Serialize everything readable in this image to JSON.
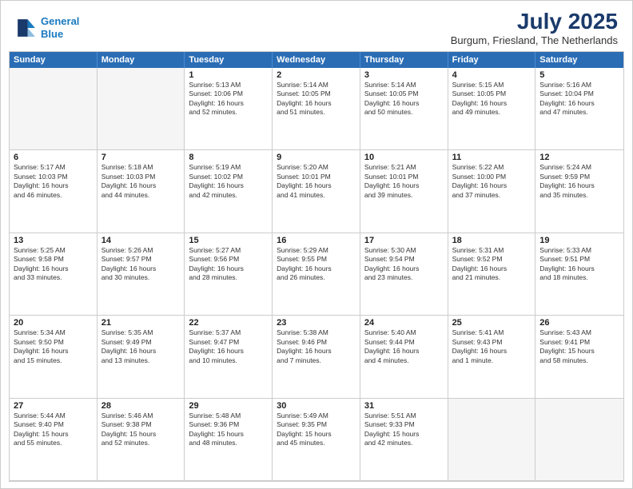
{
  "header": {
    "logo_line1": "General",
    "logo_line2": "Blue",
    "month_year": "July 2025",
    "location": "Burgum, Friesland, The Netherlands"
  },
  "day_headers": [
    "Sunday",
    "Monday",
    "Tuesday",
    "Wednesday",
    "Thursday",
    "Friday",
    "Saturday"
  ],
  "cells": [
    {
      "day": "",
      "info": ""
    },
    {
      "day": "",
      "info": ""
    },
    {
      "day": "1",
      "info": "Sunrise: 5:13 AM\nSunset: 10:06 PM\nDaylight: 16 hours\nand 52 minutes."
    },
    {
      "day": "2",
      "info": "Sunrise: 5:14 AM\nSunset: 10:05 PM\nDaylight: 16 hours\nand 51 minutes."
    },
    {
      "day": "3",
      "info": "Sunrise: 5:14 AM\nSunset: 10:05 PM\nDaylight: 16 hours\nand 50 minutes."
    },
    {
      "day": "4",
      "info": "Sunrise: 5:15 AM\nSunset: 10:05 PM\nDaylight: 16 hours\nand 49 minutes."
    },
    {
      "day": "5",
      "info": "Sunrise: 5:16 AM\nSunset: 10:04 PM\nDaylight: 16 hours\nand 47 minutes."
    },
    {
      "day": "6",
      "info": "Sunrise: 5:17 AM\nSunset: 10:03 PM\nDaylight: 16 hours\nand 46 minutes."
    },
    {
      "day": "7",
      "info": "Sunrise: 5:18 AM\nSunset: 10:03 PM\nDaylight: 16 hours\nand 44 minutes."
    },
    {
      "day": "8",
      "info": "Sunrise: 5:19 AM\nSunset: 10:02 PM\nDaylight: 16 hours\nand 42 minutes."
    },
    {
      "day": "9",
      "info": "Sunrise: 5:20 AM\nSunset: 10:01 PM\nDaylight: 16 hours\nand 41 minutes."
    },
    {
      "day": "10",
      "info": "Sunrise: 5:21 AM\nSunset: 10:01 PM\nDaylight: 16 hours\nand 39 minutes."
    },
    {
      "day": "11",
      "info": "Sunrise: 5:22 AM\nSunset: 10:00 PM\nDaylight: 16 hours\nand 37 minutes."
    },
    {
      "day": "12",
      "info": "Sunrise: 5:24 AM\nSunset: 9:59 PM\nDaylight: 16 hours\nand 35 minutes."
    },
    {
      "day": "13",
      "info": "Sunrise: 5:25 AM\nSunset: 9:58 PM\nDaylight: 16 hours\nand 33 minutes."
    },
    {
      "day": "14",
      "info": "Sunrise: 5:26 AM\nSunset: 9:57 PM\nDaylight: 16 hours\nand 30 minutes."
    },
    {
      "day": "15",
      "info": "Sunrise: 5:27 AM\nSunset: 9:56 PM\nDaylight: 16 hours\nand 28 minutes."
    },
    {
      "day": "16",
      "info": "Sunrise: 5:29 AM\nSunset: 9:55 PM\nDaylight: 16 hours\nand 26 minutes."
    },
    {
      "day": "17",
      "info": "Sunrise: 5:30 AM\nSunset: 9:54 PM\nDaylight: 16 hours\nand 23 minutes."
    },
    {
      "day": "18",
      "info": "Sunrise: 5:31 AM\nSunset: 9:52 PM\nDaylight: 16 hours\nand 21 minutes."
    },
    {
      "day": "19",
      "info": "Sunrise: 5:33 AM\nSunset: 9:51 PM\nDaylight: 16 hours\nand 18 minutes."
    },
    {
      "day": "20",
      "info": "Sunrise: 5:34 AM\nSunset: 9:50 PM\nDaylight: 16 hours\nand 15 minutes."
    },
    {
      "day": "21",
      "info": "Sunrise: 5:35 AM\nSunset: 9:49 PM\nDaylight: 16 hours\nand 13 minutes."
    },
    {
      "day": "22",
      "info": "Sunrise: 5:37 AM\nSunset: 9:47 PM\nDaylight: 16 hours\nand 10 minutes."
    },
    {
      "day": "23",
      "info": "Sunrise: 5:38 AM\nSunset: 9:46 PM\nDaylight: 16 hours\nand 7 minutes."
    },
    {
      "day": "24",
      "info": "Sunrise: 5:40 AM\nSunset: 9:44 PM\nDaylight: 16 hours\nand 4 minutes."
    },
    {
      "day": "25",
      "info": "Sunrise: 5:41 AM\nSunset: 9:43 PM\nDaylight: 16 hours\nand 1 minute."
    },
    {
      "day": "26",
      "info": "Sunrise: 5:43 AM\nSunset: 9:41 PM\nDaylight: 15 hours\nand 58 minutes."
    },
    {
      "day": "27",
      "info": "Sunrise: 5:44 AM\nSunset: 9:40 PM\nDaylight: 15 hours\nand 55 minutes."
    },
    {
      "day": "28",
      "info": "Sunrise: 5:46 AM\nSunset: 9:38 PM\nDaylight: 15 hours\nand 52 minutes."
    },
    {
      "day": "29",
      "info": "Sunrise: 5:48 AM\nSunset: 9:36 PM\nDaylight: 15 hours\nand 48 minutes."
    },
    {
      "day": "30",
      "info": "Sunrise: 5:49 AM\nSunset: 9:35 PM\nDaylight: 15 hours\nand 45 minutes."
    },
    {
      "day": "31",
      "info": "Sunrise: 5:51 AM\nSunset: 9:33 PM\nDaylight: 15 hours\nand 42 minutes."
    },
    {
      "day": "",
      "info": ""
    },
    {
      "day": "",
      "info": ""
    }
  ]
}
